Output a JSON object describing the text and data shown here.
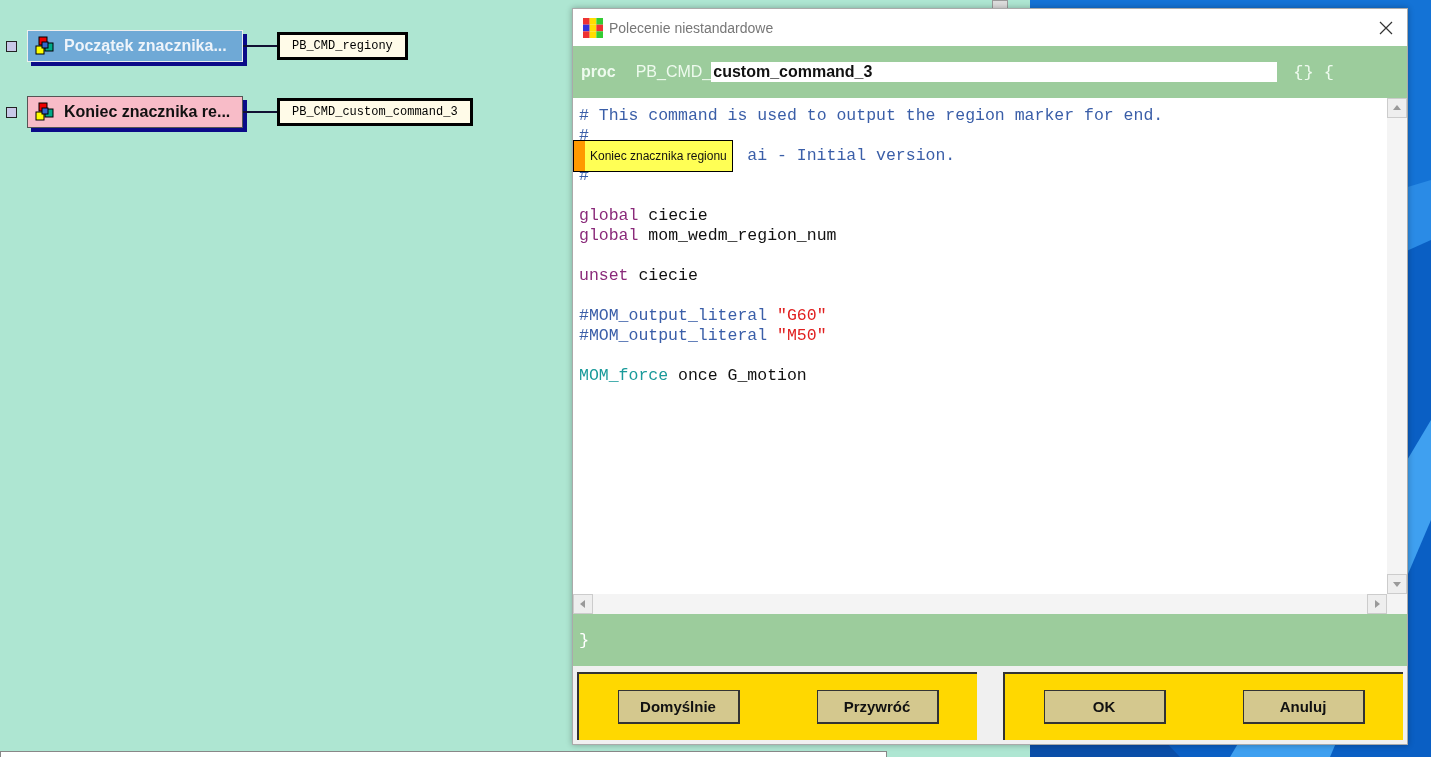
{
  "nodes": [
    {
      "label": "Początek znacznika...",
      "kind": "start",
      "command": "PB_CMD_regiony"
    },
    {
      "label": "Koniec znacznika re...",
      "kind": "end",
      "command": "PB_CMD_custom_command_3"
    }
  ],
  "dialog": {
    "title": "Polecenie niestandardowe",
    "proc_keyword": "proc",
    "proc_prefix": "PB_CMD_",
    "proc_name": "custom_command_3",
    "braces": "{} {",
    "closing_brace": "}",
    "code_lines": [
      {
        "kind": "normal",
        "segments": [
          {
            "kind": "comment",
            "text": "# This command is used to output the region marker for end."
          }
        ]
      },
      {
        "kind": "normal",
        "segments": [
          {
            "kind": "comment",
            "text": "#"
          }
        ]
      },
      {
        "kind": "covered",
        "segments": [
          {
            "kind": "comment",
            "text": "ai - Initial version."
          }
        ]
      },
      {
        "kind": "normal",
        "segments": [
          {
            "kind": "comment",
            "text": "#"
          }
        ]
      },
      {
        "kind": "blank"
      },
      {
        "kind": "normal",
        "segments": [
          {
            "kind": "keyword",
            "text": "global"
          },
          {
            "kind": "plain",
            "text": " ciecie"
          }
        ]
      },
      {
        "kind": "normal",
        "segments": [
          {
            "kind": "keyword",
            "text": "global"
          },
          {
            "kind": "plain",
            "text": " mom_wedm_region_num"
          }
        ]
      },
      {
        "kind": "blank"
      },
      {
        "kind": "normal",
        "segments": [
          {
            "kind": "keyword",
            "text": "unset"
          },
          {
            "kind": "plain",
            "text": " ciecie"
          }
        ]
      },
      {
        "kind": "blank"
      },
      {
        "kind": "normal",
        "segments": [
          {
            "kind": "comment",
            "text": "#MOM_output_literal"
          },
          {
            "kind": "string",
            "text": " \"G60\""
          }
        ]
      },
      {
        "kind": "normal",
        "segments": [
          {
            "kind": "comment",
            "text": "#MOM_output_literal"
          },
          {
            "kind": "string",
            "text": " \"M50\""
          }
        ]
      },
      {
        "kind": "blank"
      },
      {
        "kind": "normal",
        "segments": [
          {
            "kind": "command",
            "text": "MOM_force"
          },
          {
            "kind": "plain",
            "text": " once G_motion"
          }
        ]
      }
    ],
    "tooltip": "Koniec znacznika regionu",
    "left_buttons": [
      "Domyślnie",
      "Przywróć"
    ],
    "right_buttons": [
      "OK",
      "Anuluj"
    ]
  }
}
